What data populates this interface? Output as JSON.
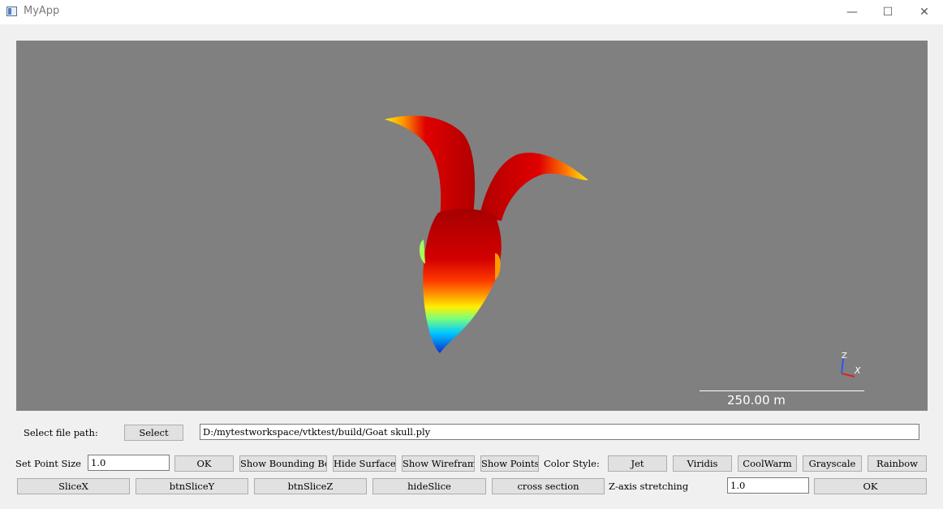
{
  "window": {
    "title": "MyApp",
    "minimize_glyph": "—",
    "maximize_glyph": "☐",
    "close_glyph": "✕"
  },
  "viewport": {
    "scale_bar_label": "250.00 m",
    "axes": {
      "z_label": "Z",
      "x_label": "X"
    },
    "colors": {
      "background": "#808080",
      "skull_gradient": [
        "#0a2fd0",
        "#00c8ff",
        "#7cff7a",
        "#ffee00",
        "#ff9a00",
        "#ff3a00",
        "#d20000",
        "#a60000"
      ]
    }
  },
  "file_row": {
    "label": "Select file path:",
    "select_label": "Select",
    "path_value": "D:/mytestworkspace/vtktest/build/Goat skull.ply"
  },
  "row1": {
    "point_size_label": "Set Point Size",
    "point_size_value": "1.0",
    "ok_label": "OK",
    "show_bounding_box": "Show Bounding Box",
    "hide_surface": "Hide Surface",
    "show_wireframe": "Show Wireframe",
    "show_points": "Show Points",
    "color_style_label": "Color Style:",
    "jet": "Jet",
    "viridis": "Viridis",
    "coolwarm": "CoolWarm",
    "grayscale": "Grayscale",
    "rainbow": "Rainbow"
  },
  "row2": {
    "slice_x": "SliceX",
    "slice_y": "btnSliceY",
    "slice_z": "btnSliceZ",
    "hide_slice": "hideSlice",
    "cross_section": "cross section",
    "z_stretch_label": "Z-axis stretching",
    "z_stretch_value": "1.0",
    "ok_label": "OK"
  }
}
